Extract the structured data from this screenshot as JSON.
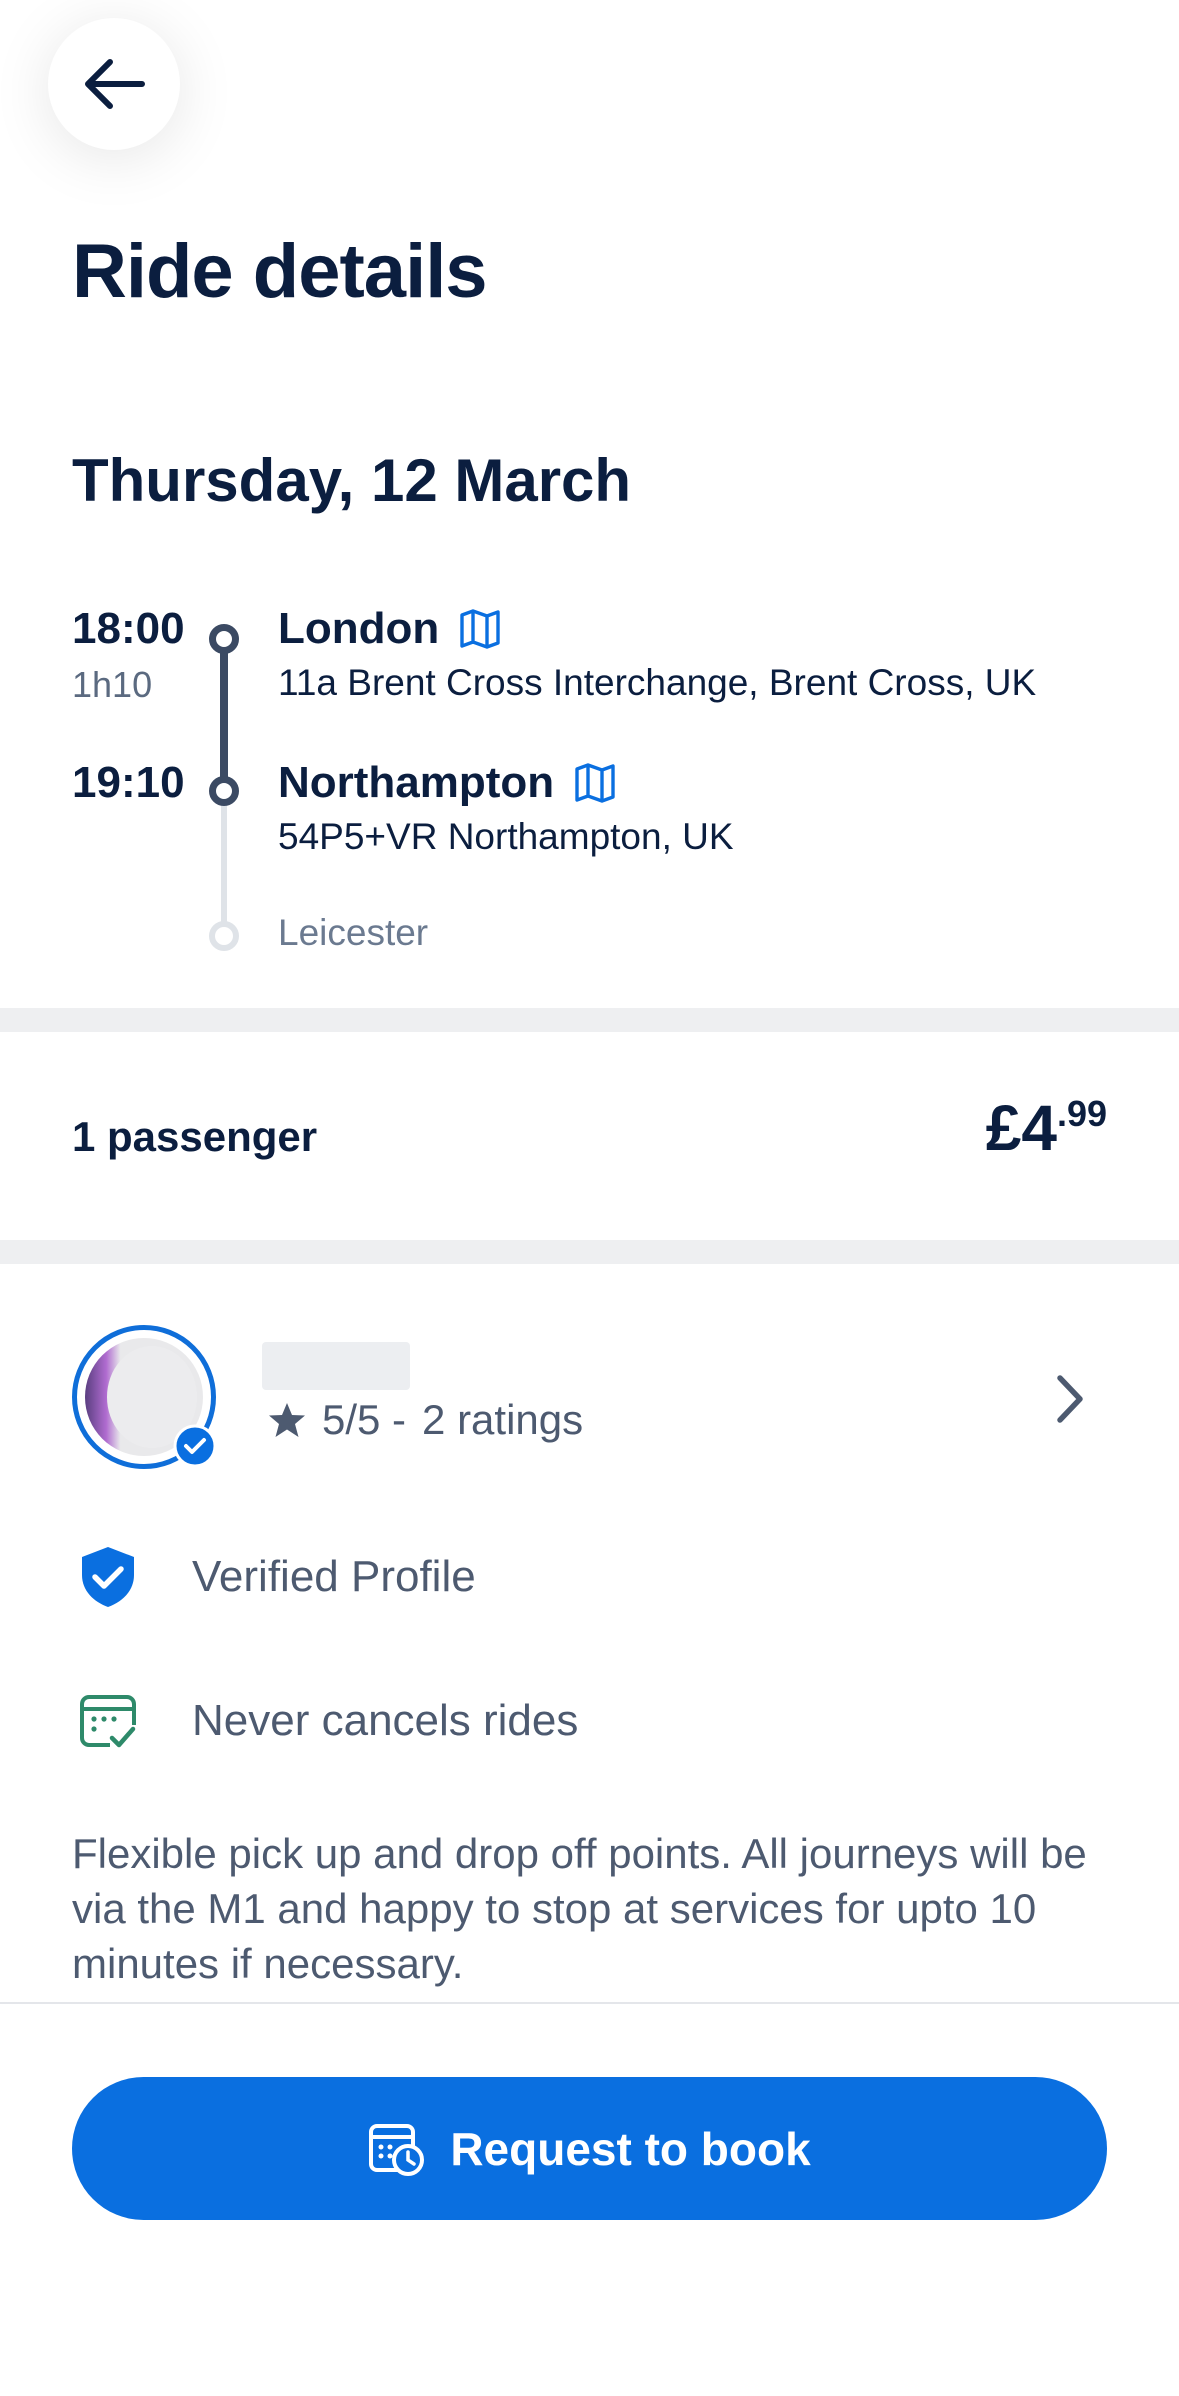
{
  "header": {
    "back_icon": "arrow-left-icon",
    "title": "Ride details"
  },
  "trip": {
    "date": "Thursday, 12 March",
    "departure": {
      "time": "18:00",
      "city": "London",
      "address": "11a Brent Cross Interchange, Brent Cross, UK"
    },
    "duration": "1h10",
    "arrival": {
      "time": "19:10",
      "city": "Northampton",
      "address": "54P5+VR Northampton, UK"
    },
    "final_stop": "Leicester",
    "map_icon": "map-icon"
  },
  "booking": {
    "passengers": "1 passenger",
    "price_main": "£4",
    "price_pence": ".99"
  },
  "driver": {
    "rating": "5/5 -",
    "ratings_count": "2 ratings",
    "features": [
      {
        "icon": "verified-shield-icon",
        "label": "Verified Profile"
      },
      {
        "icon": "calendar-check-icon",
        "label": "Never cancels rides"
      }
    ],
    "description": "Flexible pick up and drop off points. All journeys will be via the M1 and happy to stop at services for upto 10 minutes if necessary."
  },
  "cta": {
    "label": "Request to book",
    "icon": "calendar-clock-icon"
  },
  "colors": {
    "brand_blue": "#0a6fe0",
    "navy": "#0b1e3f",
    "muted": "#4d5a70",
    "icon_green": "#2e8a6a"
  }
}
